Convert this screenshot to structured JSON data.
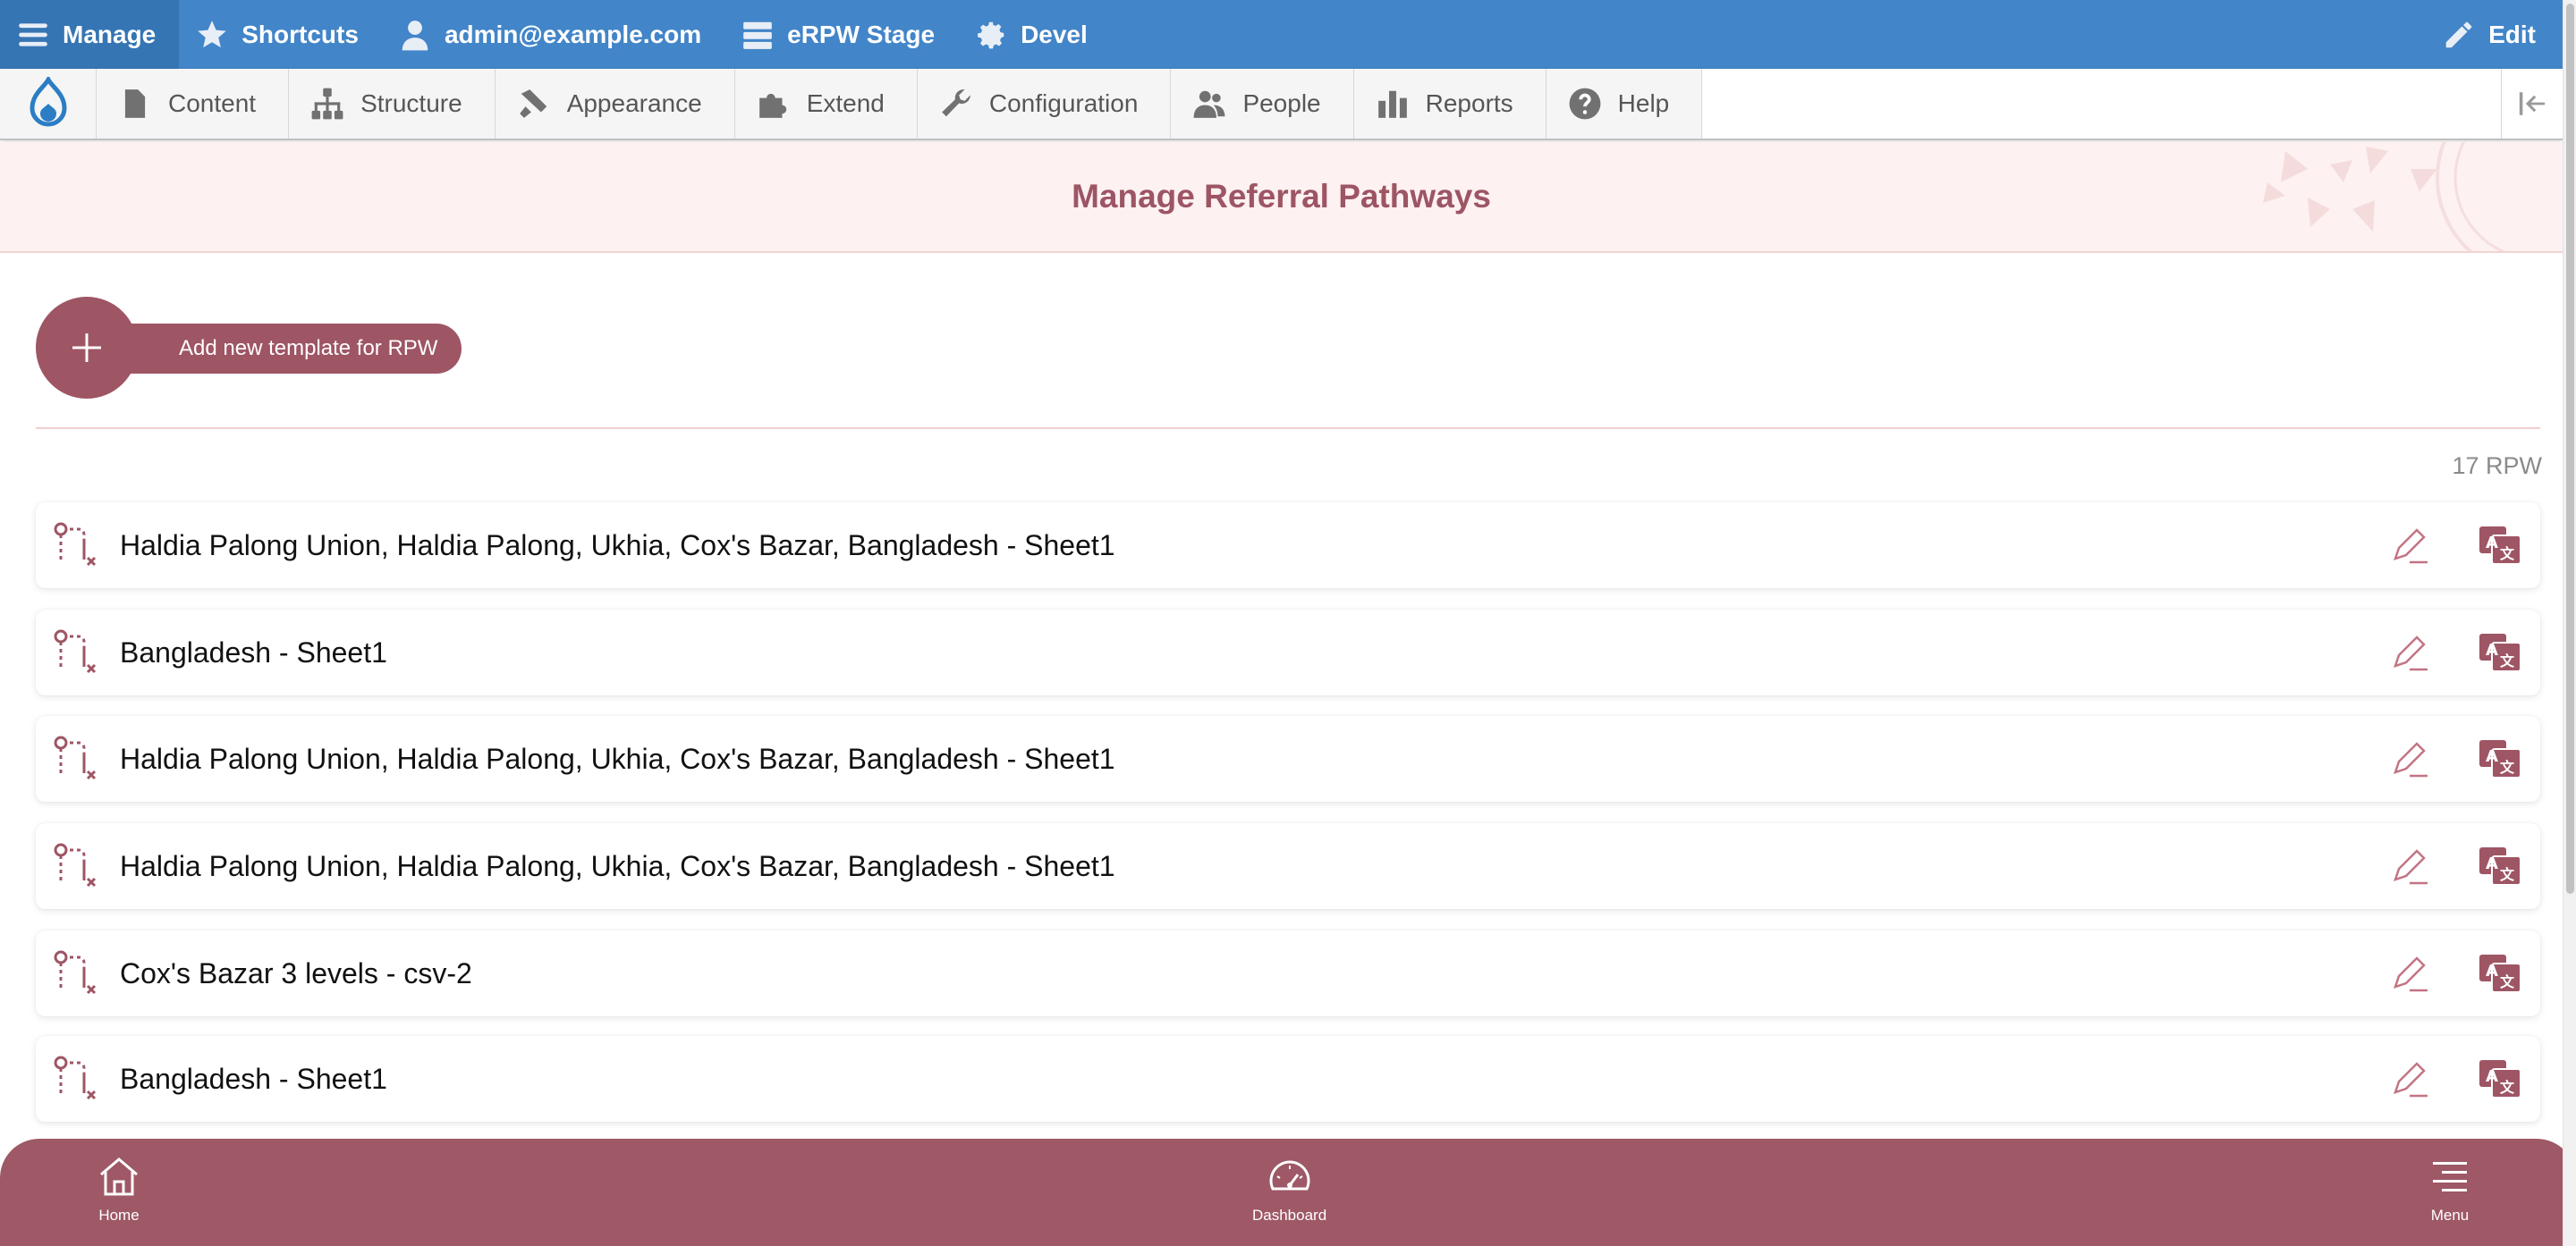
{
  "toolbar": {
    "manage_label": "Manage",
    "shortcuts_label": "Shortcuts",
    "user_label": "admin@example.com",
    "env_label": "eRPW Stage",
    "devel_label": "Devel",
    "edit_label": "Edit"
  },
  "tray": {
    "items": [
      {
        "label": "Content",
        "icon": "file-icon"
      },
      {
        "label": "Structure",
        "icon": "structure-icon"
      },
      {
        "label": "Appearance",
        "icon": "paint-icon"
      },
      {
        "label": "Extend",
        "icon": "puzzle-icon"
      },
      {
        "label": "Configuration",
        "icon": "wrench-icon"
      },
      {
        "label": "People",
        "icon": "people-icon"
      },
      {
        "label": "Reports",
        "icon": "bar-chart-icon"
      },
      {
        "label": "Help",
        "icon": "help-icon"
      }
    ]
  },
  "page": {
    "title": "Manage Referral Pathways",
    "add_button_label": "Add new template for RPW",
    "count_label": "17 RPW"
  },
  "rpw_items": [
    {
      "label": "Haldia Palong Union, Haldia Palong, Ukhia, Cox's Bazar, Bangladesh - Sheet1"
    },
    {
      "label": "Bangladesh - Sheet1"
    },
    {
      "label": "Haldia Palong Union, Haldia Palong, Ukhia, Cox's Bazar, Bangladesh - Sheet1"
    },
    {
      "label": "Haldia Palong Union, Haldia Palong, Ukhia, Cox's Bazar, Bangladesh - Sheet1"
    },
    {
      "label": "Cox's Bazar 3 levels - csv-2"
    },
    {
      "label": "Bangladesh - Sheet1"
    }
  ],
  "bottom_nav": {
    "home_label": "Home",
    "dashboard_label": "Dashboard",
    "menu_label": "Menu"
  },
  "colors": {
    "toolbar_blue": "#4285c8",
    "brand_maroon": "#9e5564",
    "header_bg": "#fdf1f1"
  }
}
